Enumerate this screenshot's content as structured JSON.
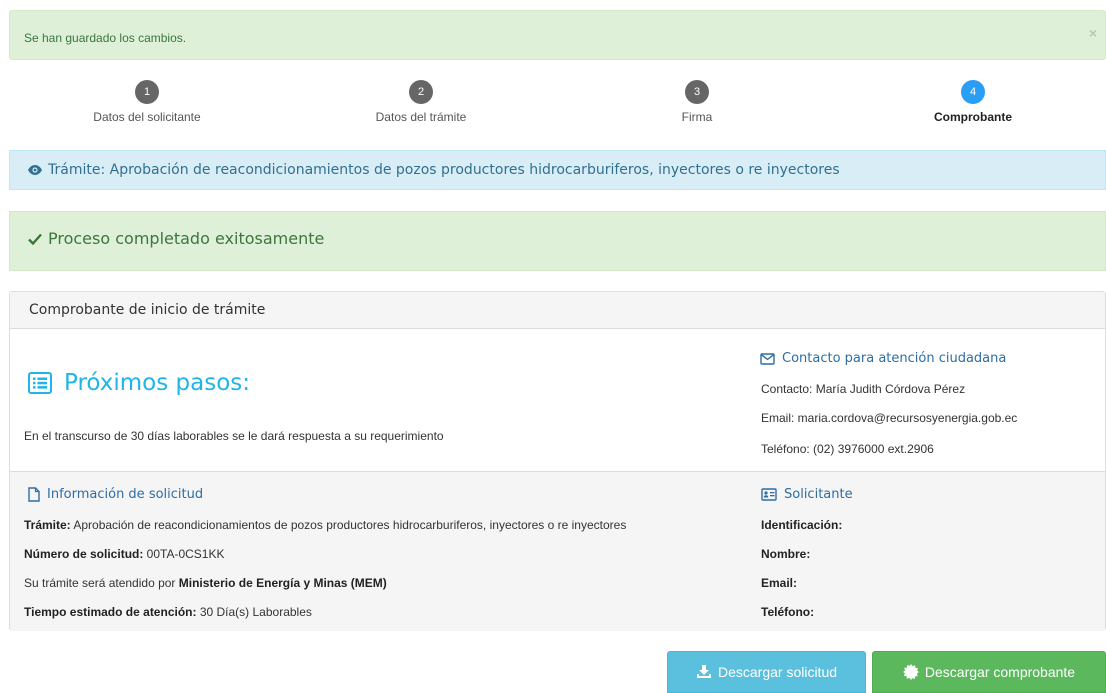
{
  "alert": {
    "message": "Se han guardado los cambios.",
    "close": "×"
  },
  "wizard": {
    "steps": [
      {
        "number": "1",
        "label": "Datos del solicitante"
      },
      {
        "number": "2",
        "label": "Datos del trámite"
      },
      {
        "number": "3",
        "label": "Firma"
      },
      {
        "number": "4",
        "label": "Comprobante",
        "active": true
      }
    ]
  },
  "tramite_banner": "Trámite: Aprobación de reacondicionamientos de pozos productores hidrocarburiferos, inyectores o re inyectores",
  "success_banner": "Proceso completado exitosamente",
  "panel": {
    "title": "Comprobante de inicio de trámite",
    "next_steps": {
      "title": "Próximos pasos:",
      "description": "En el transcurso de 30 días laborables se le dará respuesta a su requerimiento"
    },
    "contact": {
      "title": "Contacto para atención ciudadana",
      "contact_line": "Contacto: María Judith Córdova Pérez",
      "email_line": "Email: maria.cordova@recursosyenergia.gob.ec",
      "phone_line": "Teléfono: (02) 3976000 ext.2906"
    },
    "request_info": {
      "title": "Información de solicitud",
      "tramite_label": "Trámite:",
      "tramite_value": " Aprobación de reacondicionamientos de pozos productores hidrocarburiferos, inyectores o re inyectores",
      "number_label": "Número de solicitud:",
      "number_value": " 00TA-0CS1KK",
      "attended_text": "Su trámite será atendido por ",
      "attended_value": "Ministerio de Energía y Minas (MEM)",
      "time_label": "Tiempo estimado de atención:",
      "time_value": " 30 Día(s) Laborables"
    },
    "applicant": {
      "title": "Solicitante",
      "id_label": "Identificación:",
      "name_label": "Nombre:",
      "email_label": "Email:",
      "phone_label": "Teléfono:"
    }
  },
  "buttons": {
    "download_request": "Descargar solicitud",
    "download_receipt": "Descargar comprobante"
  },
  "colors": {
    "accent_blue": "#2a9df4",
    "next_steps_cyan": "#1fb5e8",
    "link_blue": "#2e6da4",
    "success_green": "#5cb85c",
    "info_blue": "#5bc0de"
  }
}
